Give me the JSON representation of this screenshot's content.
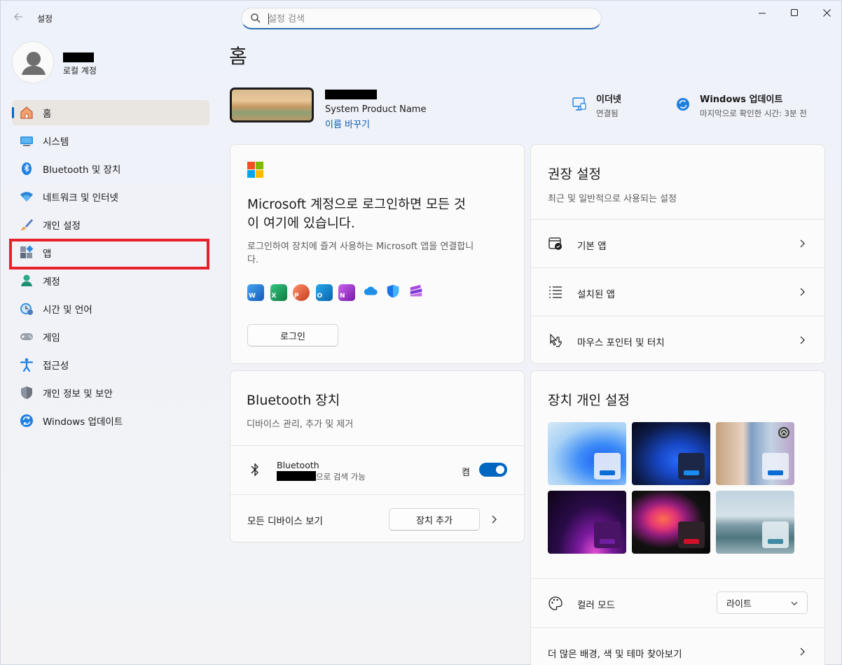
{
  "window": {
    "title": "설정"
  },
  "search": {
    "placeholder": "설정 검색"
  },
  "profile": {
    "account_type": "로컬 계정"
  },
  "sidebar": {
    "items": [
      {
        "label": "홈",
        "icon": "home-icon"
      },
      {
        "label": "시스템",
        "icon": "system-icon"
      },
      {
        "label": "Bluetooth 및 장치",
        "icon": "bluetooth-icon"
      },
      {
        "label": "네트워크 및 인터넷",
        "icon": "wifi-icon"
      },
      {
        "label": "개인 설정",
        "icon": "brush-icon"
      },
      {
        "label": "앱",
        "icon": "apps-icon"
      },
      {
        "label": "계정",
        "icon": "account-icon"
      },
      {
        "label": "시간 및 언어",
        "icon": "clock-globe-icon"
      },
      {
        "label": "게임",
        "icon": "gamepad-icon"
      },
      {
        "label": "접근성",
        "icon": "accessibility-icon"
      },
      {
        "label": "개인 정보 및 보안",
        "icon": "shield-icon"
      },
      {
        "label": "Windows 업데이트",
        "icon": "update-icon"
      }
    ]
  },
  "main": {
    "title": "홈",
    "device": {
      "model": "System Product Name",
      "rename": "이름 바꾸기"
    },
    "status": {
      "ethernet": {
        "title": "이더넷",
        "sub": "연결됨"
      },
      "update": {
        "title": "Windows 업데이트",
        "sub": "마지막으로 확인한 시간: 3분 전"
      }
    },
    "ms_card": {
      "title_line1": "Microsoft 계정으로 로그인하면 모든 것",
      "title_line2": "이 여기에 있습니다.",
      "desc_line1": "로그인하여 장치에 즐겨 사용하는 Microsoft 앱을 연결합니",
      "desc_line2": "다.",
      "apps": [
        "Word",
        "Excel",
        "PowerPoint",
        "Outlook",
        "OneNote",
        "OneDrive",
        "Defender",
        "Clipchamp"
      ],
      "signin": "로그인"
    },
    "bt_card": {
      "title": "Bluetooth 장치",
      "sub": "디바이스 관리, 추가 및 제거",
      "bt_label": "Bluetooth",
      "bt_status": "으로 검색 가능",
      "toggle_label": "켬",
      "toggle_on": true,
      "all_devices": "모든 디바이스 보기",
      "add_device": "장치 추가"
    },
    "rec_card": {
      "title": "권장 설정",
      "sub": "최근 및 일반적으로 사용되는 설정",
      "rows": [
        "기본 앱",
        "설치된 앱",
        "마우스 포인터 및 터치"
      ]
    },
    "personalize": {
      "title": "장치 개인 설정",
      "color_mode_label": "컬러 모드",
      "color_mode_value": "라이트",
      "more": "더 많은 배경, 색 및 테마 찾아보기"
    }
  }
}
